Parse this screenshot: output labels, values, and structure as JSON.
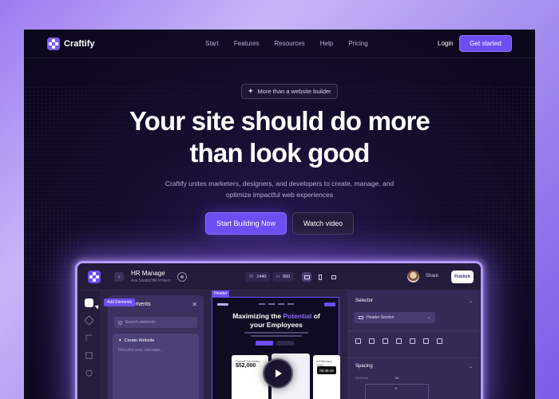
{
  "brand": {
    "name": "Craftify",
    "accent": "#6d4ef2"
  },
  "nav": {
    "links": [
      "Start",
      "Features",
      "Resources",
      "Help",
      "Pricing"
    ],
    "login": "Login",
    "cta": "Get started"
  },
  "hero": {
    "badge": "More than a website builder",
    "headline_1": "Your site should do more",
    "headline_2": "than look good",
    "sub_1": "Craftify unites marketers, designers, and developers to create, manage, and",
    "sub_2": "optimize impactful web experiences",
    "primary_cta": "Start Building Now",
    "secondary_cta": "Watch video"
  },
  "editor": {
    "project_title": "HR Manage",
    "project_subtitle": "Axe Studio/HR Project",
    "width_label": "W",
    "width_value": "1440",
    "height_label": "H",
    "height_value": "900",
    "share": "Share",
    "publish": "Publish",
    "tooltip": "Add Elements",
    "left_panel": {
      "title": "Add Elements",
      "search_placeholder": "Search elements",
      "card_title": "Create Website",
      "card_desc": "Describe your concepts..."
    },
    "canvas": {
      "tag": "Header",
      "headline_1a": "Maximizing the ",
      "headline_1b": "Potential",
      "headline_1c": " of",
      "headline_2": "your Employees",
      "card1_label": "Payroll Summary",
      "card1_value": "$52,000",
      "card3_label": "3 February, 2023",
      "card3_clock": "05:45:19"
    },
    "right_panel": {
      "selector": "Selector",
      "selector_value": "Header Section",
      "spacing": "Spacing",
      "margin_label": "MARGIN",
      "margin_value": "24",
      "inner_value": "0"
    }
  }
}
